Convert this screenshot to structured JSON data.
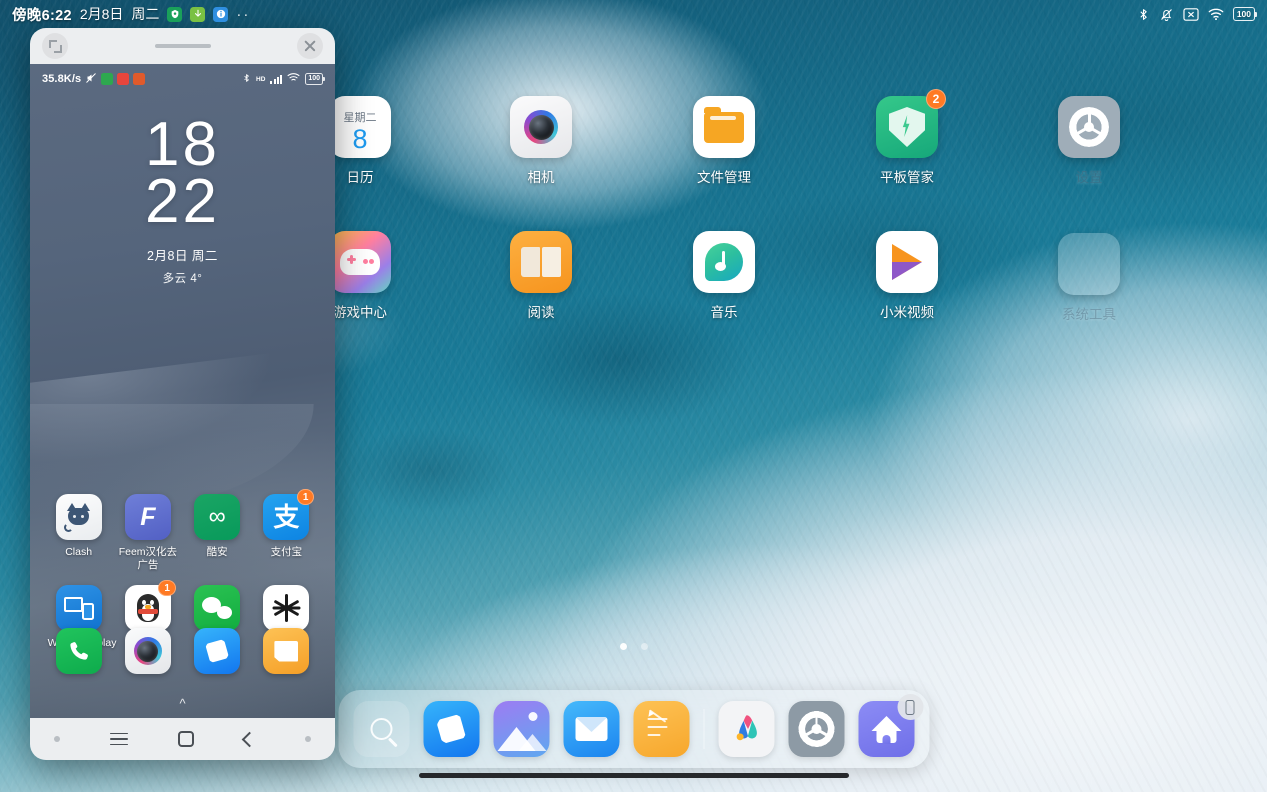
{
  "statusbar": {
    "time": "傍晚6:22",
    "date": "2月8日",
    "weekday": "周二",
    "overflow": "··",
    "notif_icons": [
      {
        "name": "shield-icon",
        "color": "#1aa05a"
      },
      {
        "name": "download-icon",
        "color": "#7ac143"
      },
      {
        "name": "info-icon",
        "color": "#2f8fe0"
      }
    ],
    "right_icons": [
      "bluetooth-icon",
      "bell-muted-icon",
      "x-box-icon",
      "wifi-icon"
    ],
    "battery": "100"
  },
  "desktop": {
    "row1": [
      {
        "label": "日历",
        "icon": "calendar-icon",
        "weekday": "星期二",
        "day": "8"
      },
      {
        "label": "相机",
        "icon": "camera-icon"
      },
      {
        "label": "文件管理",
        "icon": "file-manager-icon"
      },
      {
        "label": "平板管家",
        "icon": "security-shield-icon",
        "badge": "2"
      },
      {
        "label": "设置",
        "icon": "settings-gear-icon"
      }
    ],
    "row2": [
      {
        "label": "游戏中心",
        "icon": "gamepad-icon"
      },
      {
        "label": "阅读",
        "icon": "book-icon"
      },
      {
        "label": "音乐",
        "icon": "music-note-icon"
      },
      {
        "label": "小米视频",
        "icon": "video-play-icon"
      },
      {
        "label": "系统工具",
        "icon": "folder-group-icon",
        "mini": [
          "#3d9ae8",
          "#f5a623",
          "#f5a623",
          "#2b2b2b",
          "#e8453c",
          "#2ea84f",
          "#3bbf68",
          "#2fa8e0",
          "#ef6a3c",
          "#2f8fe0",
          "#3d9ae8"
        ]
      }
    ],
    "page_dots": 2,
    "active_dot": 0
  },
  "dock": {
    "items": [
      {
        "label": "搜索",
        "icon": "search-icon"
      },
      {
        "label": "浏览器",
        "icon": "browser-icon"
      },
      {
        "label": "相册",
        "icon": "gallery-icon"
      },
      {
        "label": "邮件",
        "icon": "mail-icon"
      },
      {
        "label": "便签",
        "icon": "notes-icon"
      },
      {
        "label": "创意云",
        "icon": "adobe-icon"
      },
      {
        "label": "设置",
        "icon": "settings-gear-icon"
      },
      {
        "label": "主屏幕",
        "icon": "home-icon",
        "badge": "tablet-icon"
      }
    ]
  },
  "phone_window": {
    "titlebar": {
      "expand": "expand-icon",
      "handle": "drag-handle",
      "close": "close-icon"
    },
    "statusbar": {
      "net_speed": "35.8K/s",
      "mute": "mute-icon",
      "app_icons": [
        "#2ea84f",
        "#e8453c",
        "#e05a2b"
      ],
      "bluetooth": "bluetooth-icon",
      "signal_hd": "HD",
      "wifi": "wifi-icon",
      "battery": "100"
    },
    "clock": {
      "hour": "18",
      "minute": "22",
      "date": "2月8日  周二",
      "weather": "多云  4°"
    },
    "apps_row1": [
      {
        "label": "Clash",
        "icon": "clash-cat-icon"
      },
      {
        "label": "Feem汉化去广告",
        "icon": "feem-icon"
      },
      {
        "label": "酷安",
        "icon": "coolapk-icon"
      },
      {
        "label": "支付宝",
        "icon": "alipay-icon",
        "badge": "1"
      }
    ],
    "apps_row2": [
      {
        "label": "WiredXDisplay",
        "icon": "wiredxdisplay-icon"
      },
      {
        "label": "QQ",
        "icon": "qq-penguin-icon",
        "badge": "1"
      },
      {
        "label": "微信",
        "icon": "wechat-icon"
      },
      {
        "label": "小黑屋",
        "icon": "xiaoheiwu-icon"
      }
    ],
    "expand_chevron": "chevron-up-icon",
    "dock": [
      {
        "label": "电话",
        "icon": "phone-icon"
      },
      {
        "label": "相机",
        "icon": "camera-icon"
      },
      {
        "label": "浏览器",
        "icon": "browser-icon"
      },
      {
        "label": "短信",
        "icon": "messages-icon"
      }
    ],
    "navbar": [
      "menu-icon",
      "home-icon",
      "back-icon"
    ]
  }
}
